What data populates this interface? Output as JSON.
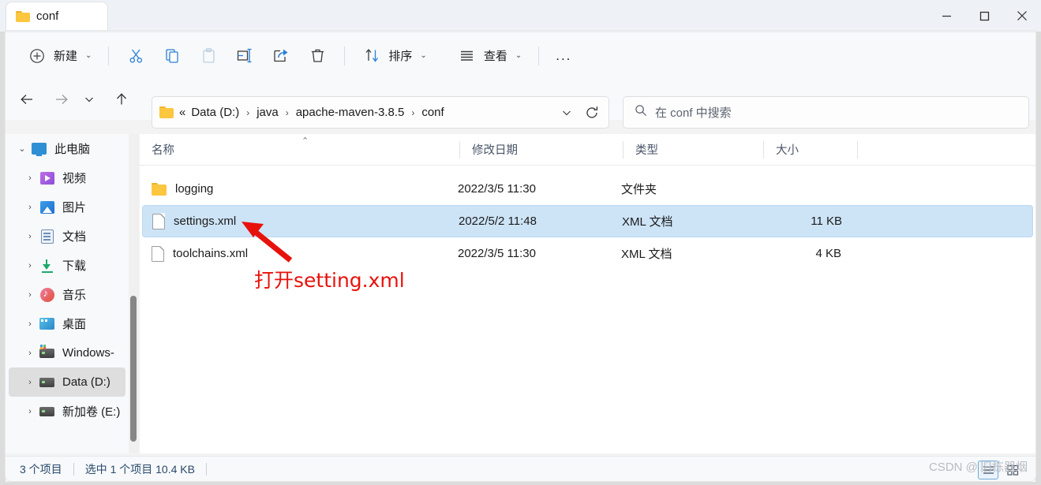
{
  "window": {
    "tab_title": "conf",
    "folder_icon": "folder-icon",
    "controls": {
      "minimize": "minimize-icon",
      "maximize": "maximize-icon",
      "close": "close-icon"
    }
  },
  "toolbar": {
    "new_label": "新建",
    "cut_label": "剪切",
    "copy_label": "复制",
    "paste_label": "粘贴",
    "rename_label": "重命名",
    "share_label": "共享",
    "delete_label": "删除",
    "sort_label": "排序",
    "view_label": "查看",
    "more_label": "..."
  },
  "navigation": {
    "back": "back-arrow-icon",
    "forward": "forward-arrow-icon",
    "recent": "chevron-down-icon",
    "up": "up-arrow-icon",
    "refresh": "refresh-icon",
    "breadcrumb_prefix": "«",
    "breadcrumb": [
      "Data (D:)",
      "java",
      "apache-maven-3.8.5",
      "conf"
    ],
    "breadcrumb_separator": "›"
  },
  "search": {
    "placeholder": "在 conf 中搜索",
    "icon": "search-icon"
  },
  "sidebar": {
    "items": [
      {
        "label": "此电脑",
        "icon": "pc-icon",
        "expanded": true,
        "level": 0,
        "selected": false
      },
      {
        "label": "视频",
        "icon": "video-icon",
        "expanded": false,
        "level": 1,
        "selected": false
      },
      {
        "label": "图片",
        "icon": "pictures-icon",
        "expanded": false,
        "level": 1,
        "selected": false
      },
      {
        "label": "文档",
        "icon": "documents-icon",
        "expanded": false,
        "level": 1,
        "selected": false
      },
      {
        "label": "下载",
        "icon": "downloads-icon",
        "expanded": false,
        "level": 1,
        "selected": false
      },
      {
        "label": "音乐",
        "icon": "music-icon",
        "expanded": false,
        "level": 1,
        "selected": false
      },
      {
        "label": "桌面",
        "icon": "desktop-icon",
        "expanded": false,
        "level": 1,
        "selected": false
      },
      {
        "label": "Windows-",
        "icon": "windows-drive-icon",
        "expanded": false,
        "level": 1,
        "selected": false
      },
      {
        "label": "Data (D:)",
        "icon": "drive-icon",
        "expanded": false,
        "level": 1,
        "selected": true
      },
      {
        "label": "新加卷 (E:)",
        "icon": "drive-icon",
        "expanded": false,
        "level": 1,
        "selected": false
      }
    ]
  },
  "filelist": {
    "columns": [
      {
        "label": "名称",
        "sorted": "asc"
      },
      {
        "label": "修改日期",
        "sorted": ""
      },
      {
        "label": "类型",
        "sorted": ""
      },
      {
        "label": "大小",
        "sorted": ""
      }
    ],
    "sort_caret": "⌃",
    "rows": [
      {
        "name": "logging",
        "date": "2022/3/5 11:30",
        "type": "文件夹",
        "size": "",
        "icon": "folder-icon",
        "selected": false
      },
      {
        "name": "settings.xml",
        "date": "2022/5/2 11:48",
        "type": "XML 文档",
        "size": "11 KB",
        "icon": "file-icon",
        "selected": true
      },
      {
        "name": "toolchains.xml",
        "date": "2022/3/5 11:30",
        "type": "XML 文档",
        "size": "4 KB",
        "icon": "file-icon",
        "selected": false
      }
    ]
  },
  "statusbar": {
    "item_count": "3 个项目",
    "selection": "选中 1 个项目  10.4 KB",
    "view_details": "details-view-icon",
    "view_large": "large-icons-view-icon"
  },
  "annotation": {
    "text": "打开setting.xml",
    "color": "#e8120c",
    "arrow": "red-arrow-icon"
  },
  "watermark": {
    "text": "CSDN @旧栋器烟"
  }
}
